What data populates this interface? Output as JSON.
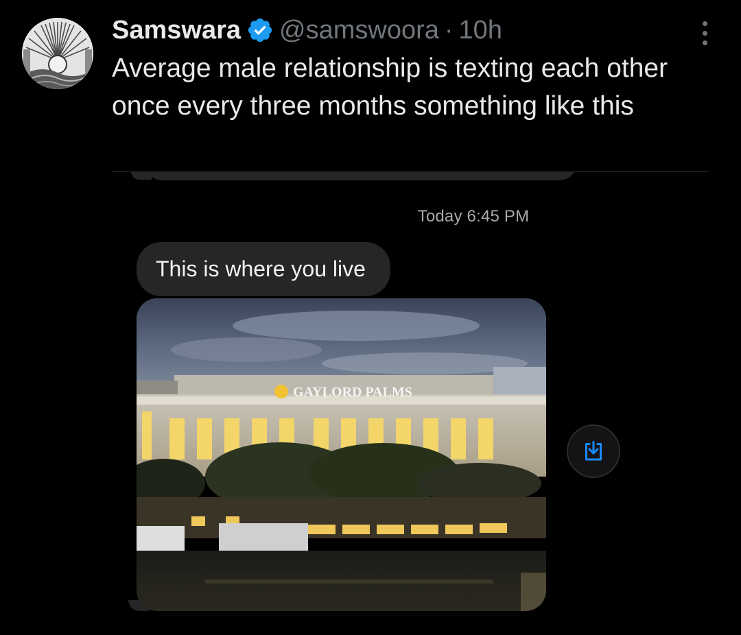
{
  "tweet": {
    "display_name": "Samswara",
    "handle": "@samswoora",
    "separator": "·",
    "time_ago": "10h",
    "text": "Average male relationship is texting each other once every three months something like this"
  },
  "embed": {
    "timestamp": "Today 6:45 PM",
    "message": "This is where you live",
    "photo_sign_text": "GAYLORD PALMS"
  },
  "icons": {
    "verified": "verified-badge-icon",
    "more": "more-options-icon",
    "save": "save-download-icon"
  },
  "colors": {
    "background": "#000000",
    "verified_blue": "#1d9bf0",
    "bubble_gray": "#262628",
    "save_icon_blue": "#1a8cff"
  }
}
